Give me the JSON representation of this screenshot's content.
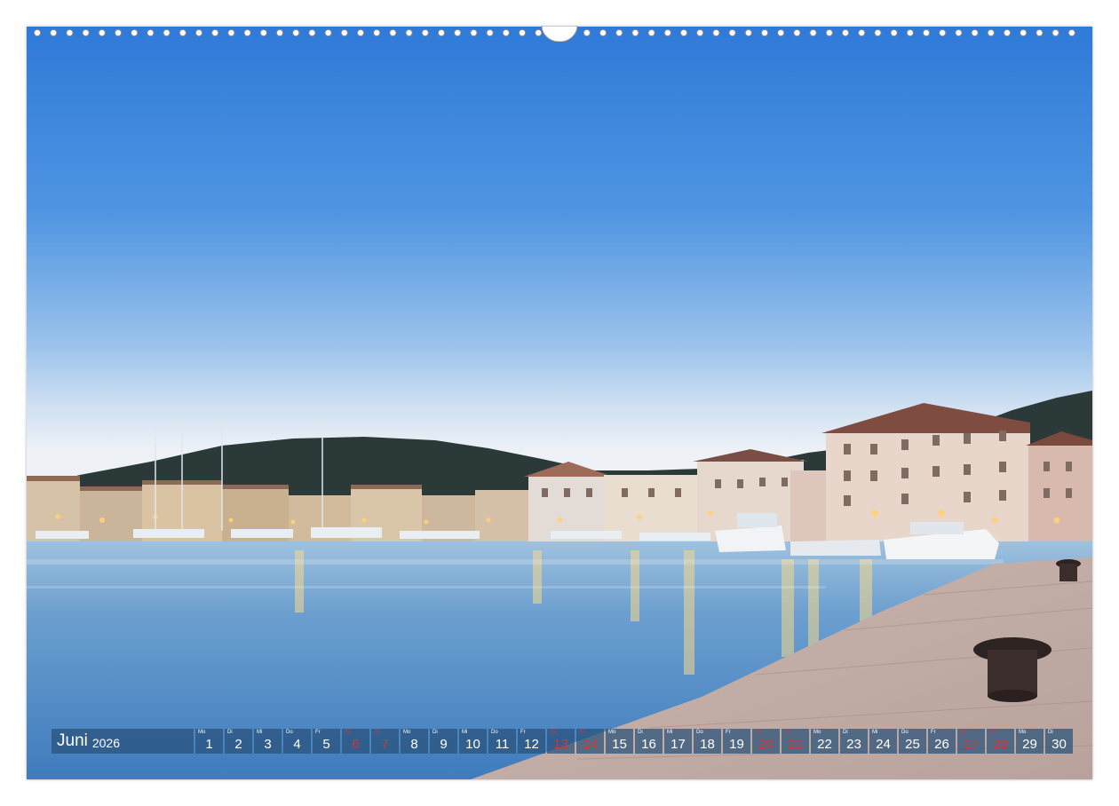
{
  "calendar": {
    "month": "Juni",
    "year": "2026",
    "weekend_color": "#d4343e",
    "days": [
      {
        "abbr": "Mo",
        "num": "1",
        "weekend": false
      },
      {
        "abbr": "Di",
        "num": "2",
        "weekend": false
      },
      {
        "abbr": "Mi",
        "num": "3",
        "weekend": false
      },
      {
        "abbr": "Do",
        "num": "4",
        "weekend": false
      },
      {
        "abbr": "Fr",
        "num": "5",
        "weekend": false
      },
      {
        "abbr": "Sa",
        "num": "6",
        "weekend": true
      },
      {
        "abbr": "So",
        "num": "7",
        "weekend": true
      },
      {
        "abbr": "Mo",
        "num": "8",
        "weekend": false
      },
      {
        "abbr": "Di",
        "num": "9",
        "weekend": false
      },
      {
        "abbr": "Mi",
        "num": "10",
        "weekend": false
      },
      {
        "abbr": "Do",
        "num": "11",
        "weekend": false
      },
      {
        "abbr": "Fr",
        "num": "12",
        "weekend": false
      },
      {
        "abbr": "Sa",
        "num": "13",
        "weekend": true
      },
      {
        "abbr": "So",
        "num": "14",
        "weekend": true
      },
      {
        "abbr": "Mo",
        "num": "15",
        "weekend": false
      },
      {
        "abbr": "Di",
        "num": "16",
        "weekend": false
      },
      {
        "abbr": "Mi",
        "num": "17",
        "weekend": false
      },
      {
        "abbr": "Do",
        "num": "18",
        "weekend": false
      },
      {
        "abbr": "Fr",
        "num": "19",
        "weekend": false
      },
      {
        "abbr": "Sa",
        "num": "20",
        "weekend": true
      },
      {
        "abbr": "So",
        "num": "21",
        "weekend": true
      },
      {
        "abbr": "Mo",
        "num": "22",
        "weekend": false
      },
      {
        "abbr": "Di",
        "num": "23",
        "weekend": false
      },
      {
        "abbr": "Mi",
        "num": "24",
        "weekend": false
      },
      {
        "abbr": "Do",
        "num": "25",
        "weekend": false
      },
      {
        "abbr": "Fr",
        "num": "26",
        "weekend": false
      },
      {
        "abbr": "Sa",
        "num": "27",
        "weekend": true
      },
      {
        "abbr": "So",
        "num": "28",
        "weekend": true
      },
      {
        "abbr": "Mo",
        "num": "29",
        "weekend": false
      },
      {
        "abbr": "Di",
        "num": "30",
        "weekend": false
      }
    ]
  }
}
